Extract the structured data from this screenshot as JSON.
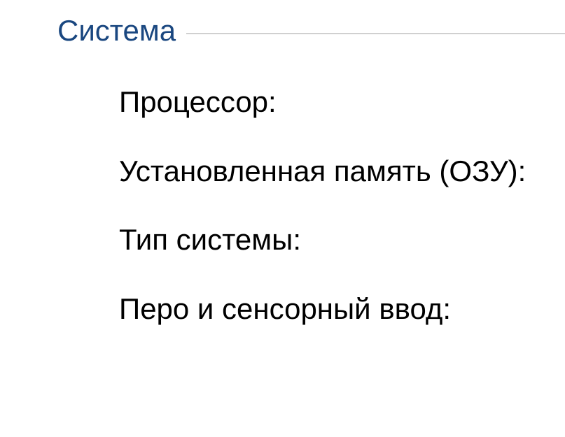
{
  "section": {
    "title": "Система",
    "properties": [
      "Процессор:",
      "Установленная память (ОЗУ):",
      "Тип системы:",
      "Перо и сенсорный ввод:"
    ]
  }
}
